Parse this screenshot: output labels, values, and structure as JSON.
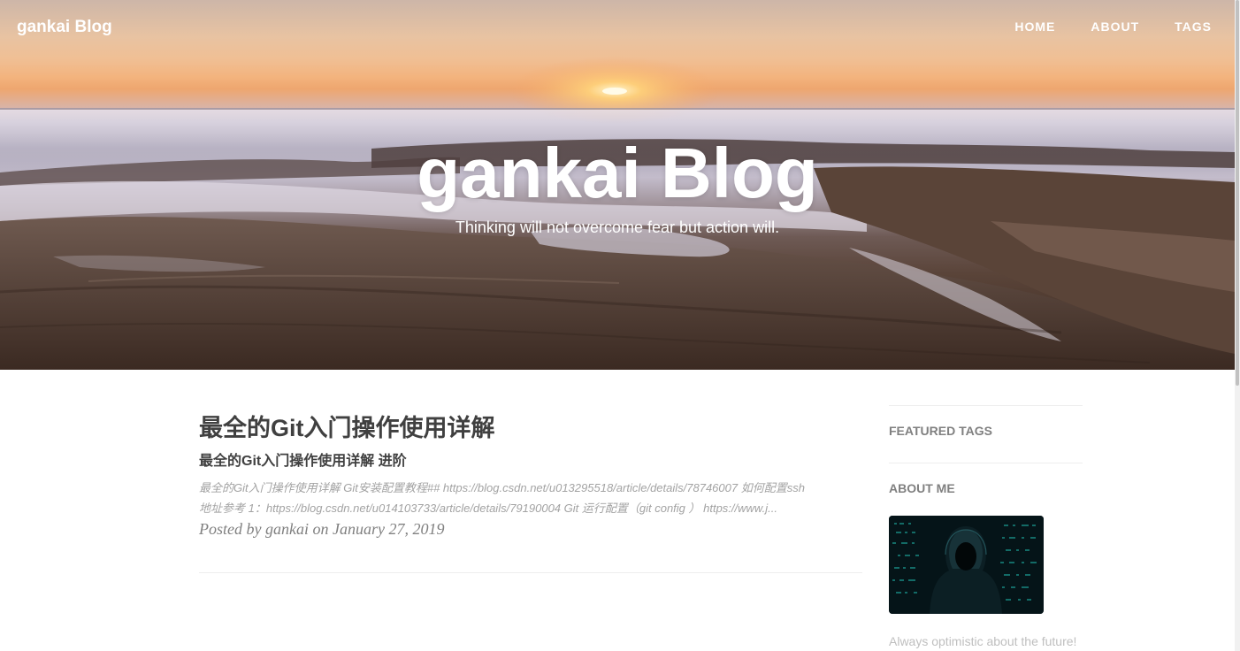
{
  "nav": {
    "brand": "gankai Blog",
    "links": [
      "HOME",
      "ABOUT",
      "TAGS"
    ]
  },
  "hero": {
    "title": "gankai Blog",
    "subtitle": "Thinking will not overcome fear but action will."
  },
  "post": {
    "title": "最全的Git入门操作使用详解",
    "subtitle": "最全的Git入门操作使用详解 进阶",
    "excerpt_line1": "最全的Git入门操作使用详解 Git安装配置教程## https://blog.csdn.net/u013295518/article/details/78746007 如何配置ssh",
    "excerpt_line2": "地址参考 1：https://blog.csdn.net/u014103733/article/details/79190004 Git 运行配置（git config ） https://www.j...",
    "meta": "Posted by gankai on January 27, 2019"
  },
  "sidebar": {
    "featured_tags_title": "FEATURED TAGS",
    "about_title": "ABOUT ME",
    "about_text": "Always optimistic about the future!",
    "avatar_icon": "hooded-figure-avatar"
  },
  "colors": {
    "text": "#404040",
    "muted": "#808080",
    "excerpt": "#a3a3a3",
    "rule": "#eeeeee",
    "avatar_accent": "#1fb3a8"
  }
}
